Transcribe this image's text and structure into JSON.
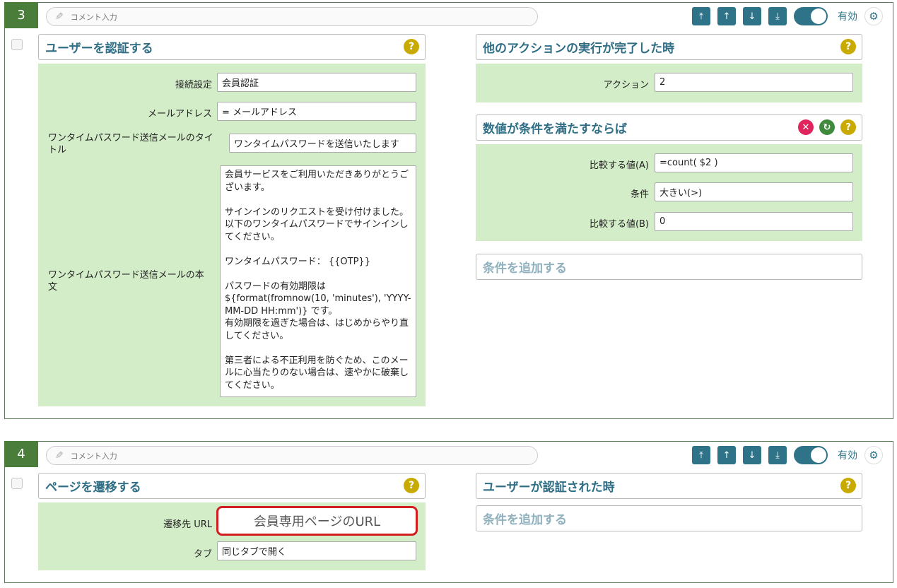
{
  "block3": {
    "number": "3",
    "comment_placeholder": "コメント入力",
    "toggle_label": "有効",
    "left_card": {
      "title": "ユーザーを認証する",
      "fields": {
        "connection_label": "接続設定",
        "connection_value": "会員認証",
        "email_label": "メールアドレス",
        "email_value": "= メールアドレス",
        "otp_title_label": "ワンタイムパスワード送信メールのタイトル",
        "otp_title_value": "ワンタイムパスワードを送信いたします",
        "otp_body_label": "ワンタイムパスワード送信メールの本文",
        "otp_body_value": "会員サービスをご利用いただきありがとうございます。\n\nサインインのリクエストを受け付けました。以下のワンタイムパスワードでサインインしてください。\n\nワンタイムパスワード： {{OTP}}\n\nパスワードの有効期限は ${format(fromnow(10, 'minutes'), 'YYYY-MM-DD HH:mm')} です。\n有効期限を過ぎた場合は、はじめからやり直してください。\n\n第三者による不正利用を防ぐため、このメールに心当たりのない場合は、速やかに破棄してください。"
      }
    },
    "right_card1": {
      "title": "他のアクションの実行が完了した時",
      "action_label": "アクション",
      "action_value": "2"
    },
    "right_card2": {
      "title": "数値が条件を満たすならば",
      "a_label": "比較する値(A)",
      "a_value": "=count( $2 )",
      "cond_label": "条件",
      "cond_value": "大きい(>)",
      "b_label": "比較する値(B)",
      "b_value": "0"
    },
    "add_condition": "条件を追加する"
  },
  "block4": {
    "number": "4",
    "comment_placeholder": "コメント入力",
    "toggle_label": "有効",
    "left_card": {
      "title": "ページを遷移する",
      "url_label": "遷移先 URL",
      "url_value": "会員専用ページのURL",
      "tab_label": "タブ",
      "tab_value": "同じタブで開く"
    },
    "right_card": {
      "title": "ユーザーが認証された時"
    },
    "add_condition": "条件を追加する"
  },
  "icons": {
    "pencil": "✎",
    "move_top": "⤒",
    "move_up": "↑",
    "move_down": "↓",
    "move_bottom": "⤓",
    "gear": "⚙",
    "help": "?",
    "delete": "✕",
    "refresh": "↻"
  },
  "colors": {
    "accent": "#2f7388",
    "block_number_bg": "#4a7c3a",
    "panel_bg": "#d4edc9",
    "help_bg": "#c9aa00",
    "delete_bg": "#e0245e",
    "refresh_bg": "#3f8a3c",
    "highlight_border": "#d21e1e"
  }
}
